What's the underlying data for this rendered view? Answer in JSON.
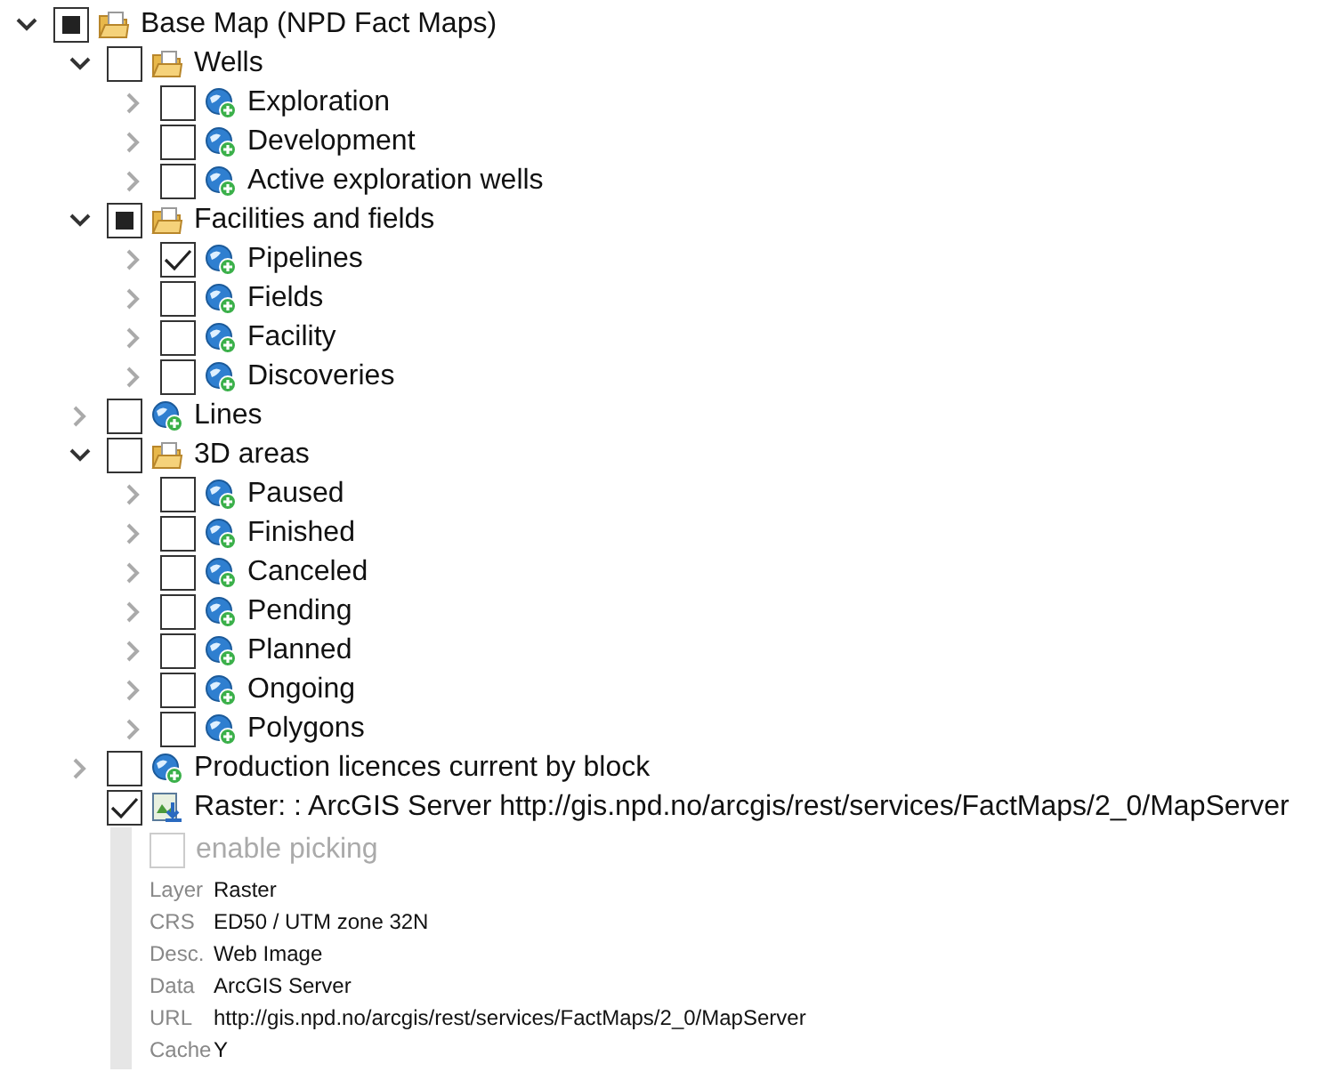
{
  "tree": [
    {
      "label": "Base Map (NPD Fact Maps)",
      "kind": "folder",
      "checked": false,
      "partial": true,
      "expanded": true,
      "children": [
        {
          "label": "Wells",
          "kind": "folder",
          "checked": false,
          "expanded": true,
          "children": [
            {
              "label": "Exploration",
              "kind": "layer",
              "checked": false,
              "expanded": false
            },
            {
              "label": "Development",
              "kind": "layer",
              "checked": false,
              "expanded": false
            },
            {
              "label": "Active exploration wells",
              "kind": "layer",
              "checked": false,
              "expanded": false
            }
          ]
        },
        {
          "label": "Facilities and fields",
          "kind": "folder",
          "checked": false,
          "partial": true,
          "expanded": true,
          "children": [
            {
              "label": "Pipelines",
              "kind": "layer",
              "checked": true,
              "expanded": false
            },
            {
              "label": "Fields",
              "kind": "layer",
              "checked": false,
              "expanded": false
            },
            {
              "label": "Facility",
              "kind": "layer",
              "checked": false,
              "expanded": false
            },
            {
              "label": "Discoveries",
              "kind": "layer",
              "checked": false,
              "expanded": false
            }
          ]
        },
        {
          "label": "Lines",
          "kind": "layer",
          "checked": false,
          "expanded": false
        },
        {
          "label": "3D areas",
          "kind": "folder",
          "checked": false,
          "expanded": true,
          "children": [
            {
              "label": "Paused",
              "kind": "layer",
              "checked": false,
              "expanded": false
            },
            {
              "label": "Finished",
              "kind": "layer",
              "checked": false,
              "expanded": false
            },
            {
              "label": "Canceled",
              "kind": "layer",
              "checked": false,
              "expanded": false
            },
            {
              "label": "Pending",
              "kind": "layer",
              "checked": false,
              "expanded": false
            },
            {
              "label": "Planned",
              "kind": "layer",
              "checked": false,
              "expanded": false
            },
            {
              "label": "Ongoing",
              "kind": "layer",
              "checked": false,
              "expanded": false
            },
            {
              "label": "Polygons",
              "kind": "layer",
              "checked": false,
              "expanded": false
            }
          ]
        },
        {
          "label": "Production licences current by block",
          "kind": "layer",
          "checked": false,
          "expanded": false
        },
        {
          "label": "Raster: : ArcGIS Server http://gis.npd.no/arcgis/rest/services/FactMaps/2_0/MapServer",
          "kind": "raster",
          "checked": true,
          "details": {
            "picking": {
              "label": "enable picking",
              "checked": false,
              "disabled": true
            },
            "rows": [
              {
                "label": "Layer",
                "value": "Raster"
              },
              {
                "label": "CRS",
                "value": "ED50 / UTM zone 32N"
              },
              {
                "label": "Desc.",
                "value": "Web Image"
              },
              {
                "label": "Data",
                "value": "ArcGIS Server"
              },
              {
                "label": "URL",
                "value": "http://gis.npd.no/arcgis/rest/services/FactMaps/2_0/MapServer"
              },
              {
                "label": "Cache",
                "value": "Y"
              }
            ]
          }
        }
      ]
    }
  ]
}
